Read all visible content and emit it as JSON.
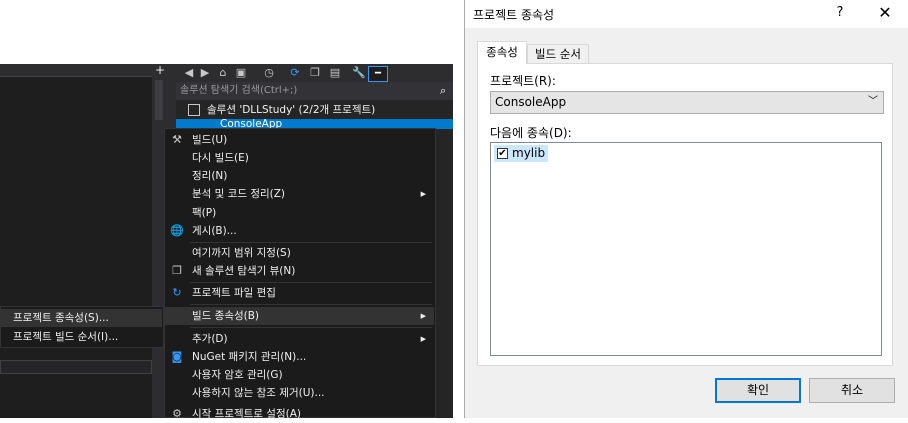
{
  "solution_explorer": {
    "search_placeholder": "솔루션 탐색기 검색(Ctrl+;)",
    "solution_label": "솔루션 'DLLStudy' (2/2개 프로젝트)",
    "project_label": "ConsoleApp"
  },
  "context_menu": {
    "items": [
      {
        "label": "빌드(U)",
        "icon": "build-icon"
      },
      {
        "label": "다시 빌드(E)"
      },
      {
        "label": "정리(N)"
      },
      {
        "label": "분석 및 코드 정리(Z)",
        "submenu": true
      },
      {
        "label": "팩(P)"
      },
      {
        "label": "게시(B)...",
        "icon": "globe-icon"
      },
      {
        "label": "여기까지 범위 지정(S)"
      },
      {
        "label": "새 솔루션 탐색기 뷰(N)",
        "icon": "new-view-icon"
      },
      {
        "label": "프로젝트 파일 편집",
        "icon": "refresh-icon"
      },
      {
        "label": "빌드 종속성(B)",
        "submenu": true,
        "highlighted": true
      },
      {
        "label": "추가(D)",
        "submenu": true
      },
      {
        "label": "NuGet 패키지 관리(N)...",
        "icon": "nuget-icon"
      },
      {
        "label": "사용자 암호 관리(G)"
      },
      {
        "label": "사용하지 않는 참조 제거(U)..."
      },
      {
        "label": "시작 프로젝트로 설정(A)",
        "icon": "gear-icon"
      }
    ]
  },
  "submenu": {
    "items": [
      {
        "label": "프로젝트 종속성(S)...",
        "highlighted": true
      },
      {
        "label": "프로젝트 빌드 순서(I)..."
      }
    ]
  },
  "dialog": {
    "title": "프로젝트 종속성",
    "help_label": "?",
    "close_label": "✕",
    "tabs": [
      {
        "label": "종속성",
        "active": true
      },
      {
        "label": "빌드 순서",
        "active": false
      }
    ],
    "project_label": "프로젝트(R):",
    "project_value": "ConsoleApp",
    "depends_on_label": "다음에 종속(D):",
    "dependencies": [
      {
        "name": "mylib",
        "checked": true
      }
    ],
    "ok_label": "확인",
    "cancel_label": "취소"
  },
  "colors": {
    "vs_background": "#252526",
    "selection_blue": "#007acc",
    "dialog_background": "#f0f0f0",
    "focus_border": "#0078d7"
  }
}
